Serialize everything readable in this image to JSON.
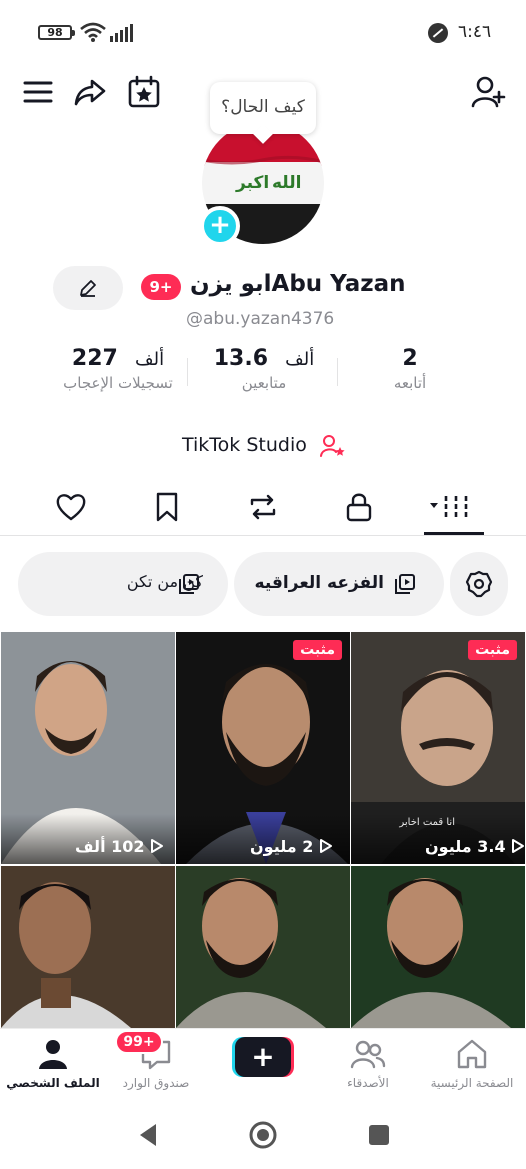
{
  "status_bar": {
    "battery": "98",
    "time": "٦:٤٦"
  },
  "profile": {
    "speech_bubble": "كيف الحال؟",
    "notification_badge": "9+",
    "display_name": "ابو يزنAbu Yazan",
    "username": "@abu.yazan4376"
  },
  "stats": {
    "likes": {
      "value": "227",
      "unit": "ألف",
      "label": "تسجيلات الإعجاب"
    },
    "followers": {
      "value": "13.6",
      "unit": "ألف",
      "label": "متابعين"
    },
    "following": {
      "value": "2",
      "label": "أتابعه"
    }
  },
  "studio_label": "TikTok Studio",
  "tabs": {
    "items": [
      "heart-icon",
      "bookmark-icon",
      "repost-icon",
      "lock-icon",
      "grid-icon"
    ],
    "active": "grid-icon"
  },
  "playlists": [
    {
      "label": "الفزعه العراقيه",
      "icon": "playlist-icon"
    },
    {
      "label": "كن من تكن",
      "icon": "playlist-icon"
    }
  ],
  "videos": [
    {
      "pinned": "مثبت",
      "views": "3.4 مليون",
      "caption": "انا قمت اخابر"
    },
    {
      "pinned": "مثبت",
      "views": "2 مليون"
    },
    {
      "views": "102 ألف"
    },
    {},
    {},
    {}
  ],
  "bottom_nav": {
    "home": "الصفحة الرئيسية",
    "friends": "الأصدقاء",
    "create": "+",
    "inbox": "صندوق الوارد",
    "inbox_badge": "99+",
    "profile": "الملف الشخصي"
  },
  "colors": {
    "accent": "#fe2c55",
    "cyan": "#20d5ec",
    "text": "#161823",
    "muted": "#8a8b91"
  }
}
